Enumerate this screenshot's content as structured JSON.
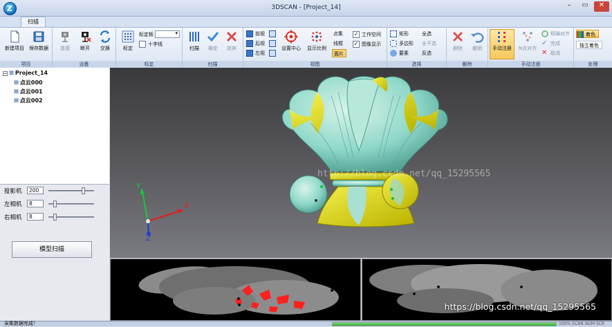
{
  "window": {
    "title": "3DSCAN - [Project_14]",
    "logo_letter": "Z"
  },
  "tabs": [
    {
      "label": "扫描"
    }
  ],
  "ribbon": {
    "groups": [
      {
        "label": "项目",
        "buttons": [
          {
            "label": "新建项目"
          },
          {
            "label": "保存数据"
          }
        ]
      },
      {
        "label": "设备",
        "buttons": [
          {
            "label": "连接"
          },
          {
            "label": "断开"
          },
          {
            "label": "交换"
          }
        ]
      },
      {
        "label": "标定",
        "buttons": [
          {
            "label": "标定"
          }
        ],
        "board_label": "标定板",
        "crosshair_label": "十字线"
      },
      {
        "label": "扫描",
        "buttons": [
          {
            "label": "扫描"
          },
          {
            "label": "确定"
          },
          {
            "label": "放弃"
          }
        ]
      },
      {
        "label": "视图",
        "views": [
          {
            "label": "前视"
          },
          {
            "label": "后视"
          },
          {
            "label": "左视"
          }
        ],
        "buttons": [
          {
            "label": "设置中心"
          },
          {
            "label": "显示比例"
          }
        ],
        "modes": [
          {
            "label": "点集"
          },
          {
            "label": "线框"
          },
          {
            "label": "面片"
          }
        ],
        "checks": [
          {
            "label": "工作空间"
          },
          {
            "label": "图像显示"
          }
        ]
      },
      {
        "label": "选择",
        "items": [
          {
            "label": "矩形"
          },
          {
            "label": "多边形"
          },
          {
            "label": "要素"
          },
          {
            "label": "全选"
          },
          {
            "label": "全不选"
          },
          {
            "label": "反选"
          }
        ]
      },
      {
        "label": "删除",
        "buttons": [
          {
            "label": "删除"
          },
          {
            "label": "撤销"
          }
        ]
      },
      {
        "label": "手动注册",
        "buttons": [
          {
            "label": "手动注册"
          },
          {
            "label": "N点对齐"
          }
        ],
        "items": [
          {
            "label": "精确对齐"
          },
          {
            "label": "完成"
          },
          {
            "label": "取消"
          }
        ]
      },
      {
        "label": "处理",
        "items": [
          {
            "label": "着色"
          },
          {
            "label": "独立着色"
          }
        ]
      }
    ]
  },
  "tree": {
    "root": "Project_14",
    "children": [
      "点云000",
      "点云001",
      "点云002"
    ]
  },
  "controls": [
    {
      "label": "投影机",
      "value": "200",
      "level": 0.78
    },
    {
      "label": "左相机",
      "value": "8",
      "level": 0.12
    },
    {
      "label": "右相机",
      "value": "8",
      "level": 0.12
    }
  ],
  "scan_model_button": "模型扫描",
  "viewport": {
    "watermark": "http://blog.csdn.net/qq_15295565",
    "axes": {
      "x": "X",
      "y": "Y",
      "z": "Z"
    }
  },
  "camera_source": "https://blog.csdn.net/qq_15295565",
  "status": {
    "text": "采集数据完成！",
    "progress": 1.0,
    "indicators": [
      "100% SCAN",
      "NUM SCR"
    ]
  },
  "colors": {
    "mesh_teal": "#8fd8c9",
    "mesh_yellow": "#e6e000",
    "axis_x": "#e02020",
    "axis_y": "#20c040",
    "axis_z": "#2040d0",
    "capture_red": "#ff2020"
  }
}
